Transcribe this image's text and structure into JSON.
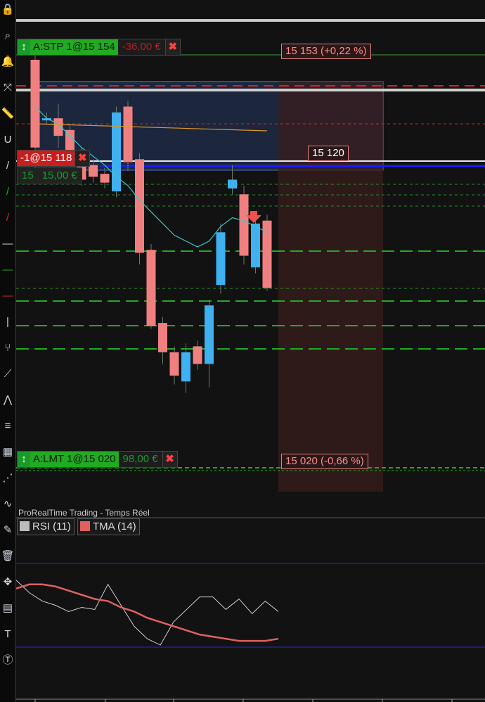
{
  "colors": {
    "background": "#121212",
    "bull_candle": "#3fb0f0",
    "bear_candle": "#f08080",
    "stop_line": "#e02020",
    "target_line": "#22aa22",
    "entry_line": "#1a1aff",
    "rsi_line": "#d0d0d0",
    "tma_line": "#e06060"
  },
  "toolbar": {
    "icons": [
      "lock-icon",
      "zoom-icon",
      "alert-icon",
      "cursor-icon",
      "ruler-icon",
      "magnet-icon",
      "line-icon",
      "line-up-icon",
      "line-down-icon",
      "horizontal-line-icon",
      "horizontal-line-up-icon",
      "horizontal-line-down-icon",
      "vertical-line-icon",
      "pitchfork-icon",
      "trend-channel-icon",
      "zigzag-icon",
      "fibonacci-icon",
      "gann-icon",
      "fib-fan-icon",
      "wave-icon",
      "tools-icon",
      "trash-icon",
      "move-icon",
      "document-icon",
      "text-icon",
      "text-circle-icon"
    ]
  },
  "orders": {
    "stop": {
      "label": "A:STP 1@15 154",
      "pnl": "-36,00 €",
      "price_label": "15 153 (+0,22 %)"
    },
    "position": {
      "label": "-1@15 118",
      "qty": "15",
      "pnl": "15,00 €",
      "price_label": "15 120"
    },
    "limit": {
      "label": "A:LMT 1@15 020",
      "pnl": "98,00 €",
      "price_label": "15 020 (-0,66 %)"
    }
  },
  "indicator_panel": {
    "title": "ProRealTime Trading - Temps Réel",
    "rsi_label": "RSI (11)",
    "tma_label": "TMA (14)"
  },
  "chart_data": [
    {
      "type": "candlestick",
      "title": "",
      "notes": "Price chart; OHLC values not printed on screen. Order levels shown.",
      "levels": {
        "stop": 15154,
        "position": 15118,
        "limit": 15020,
        "current": 15120
      },
      "candles": [
        {
          "o": 15160,
          "h": 15162,
          "l": 15128,
          "c": 15130
        },
        {
          "o": 15140,
          "h": 15142,
          "l": 15138,
          "c": 15140
        },
        {
          "o": 15140,
          "h": 15145,
          "l": 15130,
          "c": 15134
        },
        {
          "o": 15136,
          "h": 15138,
          "l": 15124,
          "c": 15126
        },
        {
          "o": 15128,
          "h": 15130,
          "l": 15117,
          "c": 15119
        },
        {
          "o": 15124,
          "h": 15126,
          "l": 15118,
          "c": 15120
        },
        {
          "o": 15121,
          "h": 15123,
          "l": 15116,
          "c": 15118
        },
        {
          "o": 15115,
          "h": 15144,
          "l": 15113,
          "c": 15142
        },
        {
          "o": 15144,
          "h": 15146,
          "l": 15122,
          "c": 15125
        },
        {
          "o": 15126,
          "h": 15128,
          "l": 15090,
          "c": 15094
        },
        {
          "o": 15095,
          "h": 15097,
          "l": 15068,
          "c": 15069
        },
        {
          "o": 15070,
          "h": 15072,
          "l": 15056,
          "c": 15060
        },
        {
          "o": 15060,
          "h": 15062,
          "l": 15049,
          "c": 15052
        },
        {
          "o": 15050,
          "h": 15063,
          "l": 15046,
          "c": 15060
        },
        {
          "o": 15062,
          "h": 15064,
          "l": 15054,
          "c": 15056
        },
        {
          "o": 15056,
          "h": 15078,
          "l": 15048,
          "c": 15076
        },
        {
          "o": 15083,
          "h": 15104,
          "l": 15080,
          "c": 15101
        },
        {
          "o": 15116,
          "h": 15124,
          "l": 15114,
          "c": 15119
        },
        {
          "o": 15114,
          "h": 15117,
          "l": 15090,
          "c": 15093
        },
        {
          "o": 15089,
          "h": 15106,
          "l": 15087,
          "c": 15104
        },
        {
          "o": 15105,
          "h": 15107,
          "l": 15081,
          "c": 15082
        }
      ],
      "moving_average": [
        15144,
        15140,
        15138,
        15134,
        15130,
        15127,
        15124,
        15120,
        15117,
        15112,
        15108,
        15104,
        15100,
        15098,
        15096,
        15098,
        15103,
        15106,
        15105,
        15103,
        15101
      ]
    },
    {
      "type": "line",
      "title": "",
      "series": [
        {
          "name": "RSI (11)",
          "values": [
            62,
            56,
            52,
            50,
            47,
            49,
            48,
            60,
            50,
            40,
            34,
            31,
            42,
            48,
            54,
            54,
            48,
            53,
            46,
            52,
            47
          ]
        },
        {
          "name": "TMA (14)",
          "values": [
            58,
            60,
            60,
            59,
            57,
            55,
            53,
            52,
            49,
            47,
            44,
            42,
            40,
            38,
            36,
            35,
            34,
            33,
            33,
            33,
            34
          ]
        }
      ],
      "ylim": [
        20,
        80
      ],
      "levels": [
        70,
        30
      ]
    }
  ]
}
